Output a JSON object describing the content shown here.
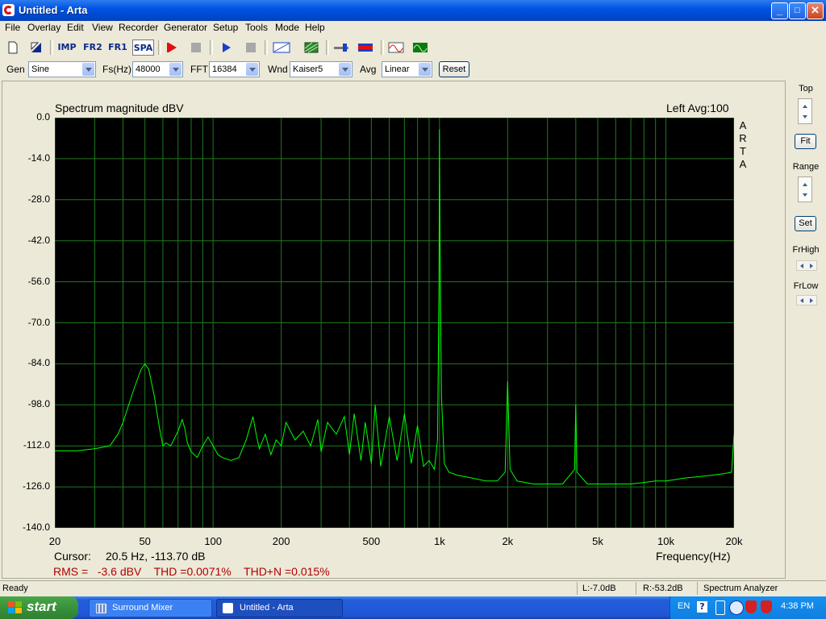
{
  "window": {
    "title": "Untitled - Arta",
    "minimize": "_",
    "maximize": "□",
    "close": "✕"
  },
  "menu": [
    "File",
    "Overlay",
    "Edit",
    "View",
    "Recorder",
    "Generator",
    "Setup",
    "Tools",
    "Mode",
    "Help"
  ],
  "toolbar": {
    "imp": "IMP",
    "fr2": "FR2",
    "fr1": "FR1",
    "spa": "SPA"
  },
  "options": {
    "gen_label": "Gen",
    "gen_value": "Sine",
    "fs_label": "Fs(Hz)",
    "fs_value": "48000",
    "fft_label": "FFT",
    "fft_value": "16384",
    "wnd_label": "Wnd",
    "wnd_value": "Kaiser5",
    "avg_label": "Avg",
    "avg_value": "Linear",
    "reset": "Reset"
  },
  "graph": {
    "title": "Spectrum magnitude dBV",
    "channel_info": "Left  Avg:100",
    "vertical_tag": [
      "A",
      "R",
      "T",
      "A"
    ],
    "cursor_label": "Cursor:",
    "cursor_value": "20.5 Hz, -113.70 dB",
    "xlabel": "Frequency(Hz)",
    "measurements": "RMS =   -3.6 dBV    THD =0.0071%    THD+N =0.015%"
  },
  "right_panel": {
    "top": "Top",
    "fit": "Fit",
    "range": "Range",
    "set": "Set",
    "frhigh": "FrHigh",
    "frlow": "FrLow"
  },
  "status": {
    "ready": "Ready",
    "left_level": "L:-7.0dB",
    "right_level": "R:-53.2dB",
    "mode": "Spectrum Analyzer"
  },
  "taskbar": {
    "start": "start",
    "tasks": [
      "Surround Mixer",
      "Untitled - Arta"
    ],
    "lang": "EN",
    "clock": "4:38 PM"
  },
  "colors": {
    "trace": "#00ff00",
    "grid": "#1f7a1f",
    "plot_bg": "#000000",
    "measure_text": "#b00000"
  },
  "chart_data": {
    "type": "line",
    "title": "Spectrum magnitude dBV",
    "xlabel": "Frequency(Hz)",
    "ylabel": "",
    "xscale": "log",
    "xlim": [
      20,
      20000
    ],
    "ylim": [
      -140,
      0
    ],
    "grid": true,
    "x_ticks": [
      "20",
      "50",
      "100",
      "200",
      "500",
      "1k",
      "2k",
      "5k",
      "10k",
      "20k"
    ],
    "x_tick_values": [
      20,
      50,
      100,
      200,
      500,
      1000,
      2000,
      5000,
      10000,
      20000
    ],
    "y_ticks": [
      "0.0",
      "-14.0",
      "-28.0",
      "-42.0",
      "-56.0",
      "-70.0",
      "-84.0",
      "-98.0",
      "-112.0",
      "-126.0",
      "-140.0"
    ],
    "series": [
      {
        "x": [
          20,
          25,
          30,
          35,
          38,
          40,
          42,
          45,
          48,
          50,
          52,
          55,
          58,
          60,
          62,
          65,
          70,
          73,
          75,
          77,
          80,
          85,
          90,
          95,
          100,
          105,
          110,
          120,
          130,
          140,
          150,
          155,
          160,
          170,
          180,
          190,
          200,
          210,
          230,
          250,
          270,
          290,
          300,
          320,
          350,
          380,
          400,
          420,
          450,
          470,
          500,
          520,
          550,
          600,
          650,
          700,
          750,
          800,
          850,
          900,
          950,
          980,
          995,
          1000,
          1005,
          1020,
          1050,
          1100,
          1200,
          1400,
          1600,
          1800,
          1950,
          2000,
          2050,
          2200,
          2600,
          3000,
          3500,
          3950,
          4000,
          4050,
          4500,
          5000,
          6000,
          7000,
          8000,
          9000,
          10000,
          11000,
          12000,
          14000,
          16000,
          18000,
          19500,
          20000
        ],
        "y": [
          -113.7,
          -113.7,
          -113,
          -112,
          -108,
          -104,
          -99,
          -92,
          -86,
          -84,
          -86,
          -95,
          -106,
          -112,
          -111,
          -112,
          -107,
          -103,
          -106,
          -111,
          -114,
          -116,
          -112,
          -109,
          -112,
          -115,
          -116,
          -117,
          -116,
          -110,
          -102,
          -108,
          -113,
          -108,
          -115,
          -110,
          -112,
          -104,
          -110,
          -107,
          -112,
          -103,
          -114,
          -104,
          -108,
          -102,
          -115,
          -101,
          -117,
          -104,
          -118,
          -98,
          -119,
          -102,
          -117,
          -101,
          -118,
          -105,
          -119,
          -117,
          -120,
          -110,
          -60,
          -4,
          -40,
          -95,
          -118,
          -121,
          -122,
          -123,
          -124,
          -124,
          -121,
          -90,
          -120,
          -124,
          -125,
          -125,
          -125,
          -120,
          -98,
          -121,
          -125,
          -125,
          -125,
          -125,
          -124.5,
          -124,
          -124,
          -123.5,
          -123,
          -122.5,
          -122,
          -121.5,
          -121,
          -108
        ]
      }
    ]
  }
}
